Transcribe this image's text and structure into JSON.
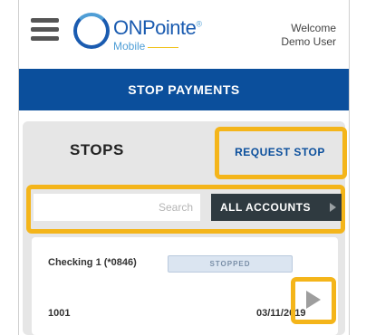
{
  "app": {
    "brand_name": "ONPointe",
    "brand_sub": "Mobile",
    "welcome_line1": "Welcome",
    "welcome_line2": "Demo User"
  },
  "page": {
    "title": "STOP PAYMENTS"
  },
  "stops": {
    "heading": "STOPS",
    "request_label": "REQUEST STOP",
    "search_placeholder": "Search",
    "accounts_label": "ALL ACCOUNTS"
  },
  "items": [
    {
      "account": "Checking 1 (*0846)",
      "status": "STOPPED",
      "check_number": "1001",
      "date": "03/11/2019"
    }
  ],
  "colors": {
    "brand_blue": "#0b4f9c",
    "highlight": "#f4b51a",
    "dark_button": "#2f3a40"
  },
  "icons": [
    "menu-icon",
    "brand-logo",
    "caret-right-icon",
    "play-arrow-icon"
  ]
}
